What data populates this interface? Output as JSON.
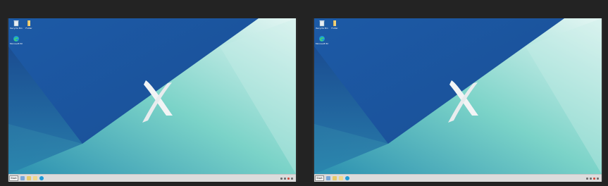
{
  "monitors": [
    {
      "id": "left",
      "desktop_icons": [
        {
          "name": "recycle-bin-icon",
          "label": "Recycle Bin"
        },
        {
          "name": "folder-icon",
          "label": "Folder"
        },
        {
          "name": "edge-icon",
          "label": "Microsoft Edge"
        }
      ],
      "taskbar": {
        "start_label": "Start",
        "pinned": [
          "search-icon",
          "file-explorer-icon",
          "folder-icon",
          "edge-icon"
        ],
        "clock_time": "",
        "clock_date": ""
      }
    },
    {
      "id": "right",
      "desktop_icons": [
        {
          "name": "recycle-bin-icon",
          "label": "Recycle Bin"
        },
        {
          "name": "folder-icon",
          "label": "Folder"
        },
        {
          "name": "edge-icon",
          "label": "Microsoft Edge"
        }
      ],
      "taskbar": {
        "start_label": "Start",
        "pinned": [
          "search-icon",
          "file-explorer-icon",
          "folder-icon",
          "edge-icon"
        ],
        "clock_time": "",
        "clock_date": ""
      }
    }
  ],
  "colors": {
    "wallpaper_deep_blue": "#1b56a0",
    "wallpaper_teal": "#6fcfc6",
    "wallpaper_light": "#dff4f1",
    "taskbar": "#dcdcdc",
    "background": "#232323"
  }
}
